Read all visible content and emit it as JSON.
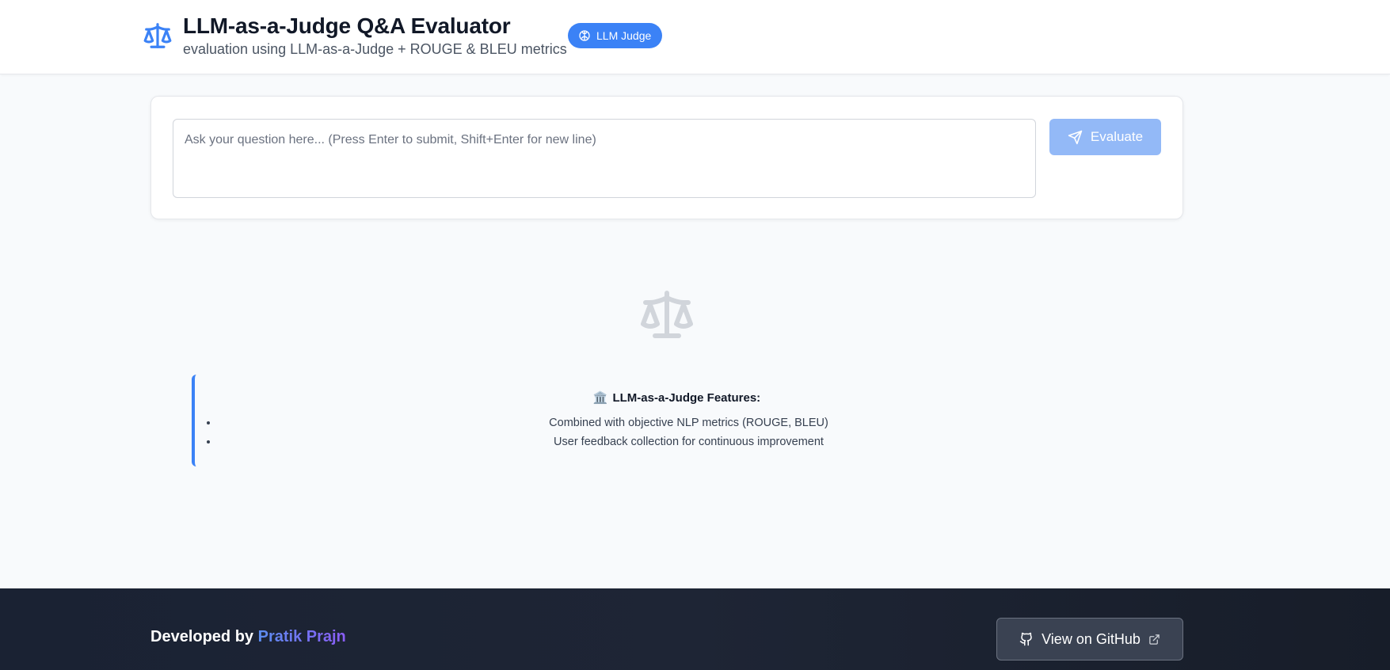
{
  "header": {
    "title": "LLM-as-a-Judge Q&A Evaluator",
    "subtitle": "evaluation using LLM-as-a-Judge + ROUGE & BLEU metrics",
    "brand_icon": "scale-icon",
    "badge": {
      "label": "LLM Judge",
      "icon": "brain-icon"
    }
  },
  "question_card": {
    "input": {
      "value": "",
      "placeholder": "Ask your question here... (Press Enter to submit, Shift+Enter for new line)"
    },
    "evaluate_button": {
      "label": "Evaluate",
      "icon": "send-icon",
      "disabled": true
    }
  },
  "empty_state": {
    "icon": "scale-icon",
    "features": {
      "emoji": "🏛️",
      "title": "LLM-as-a-Judge Features:",
      "items": [
        "Combined with objective NLP metrics (ROUGE, BLEU)",
        "User feedback collection for continuous improvement"
      ]
    }
  },
  "footer": {
    "developed_by": "Developed by",
    "developer_name": "Pratik Prajn",
    "github_button": {
      "label": "View on GitHub",
      "icon": "github-icon",
      "trailing_icon": "external-link-icon"
    }
  },
  "colors": {
    "accent": "#3b82f6",
    "accent_disabled": "#93b9f7",
    "page_background": "#f8fafc",
    "footer_background": "#1a2233",
    "muted_icon": "#d1d5db"
  }
}
